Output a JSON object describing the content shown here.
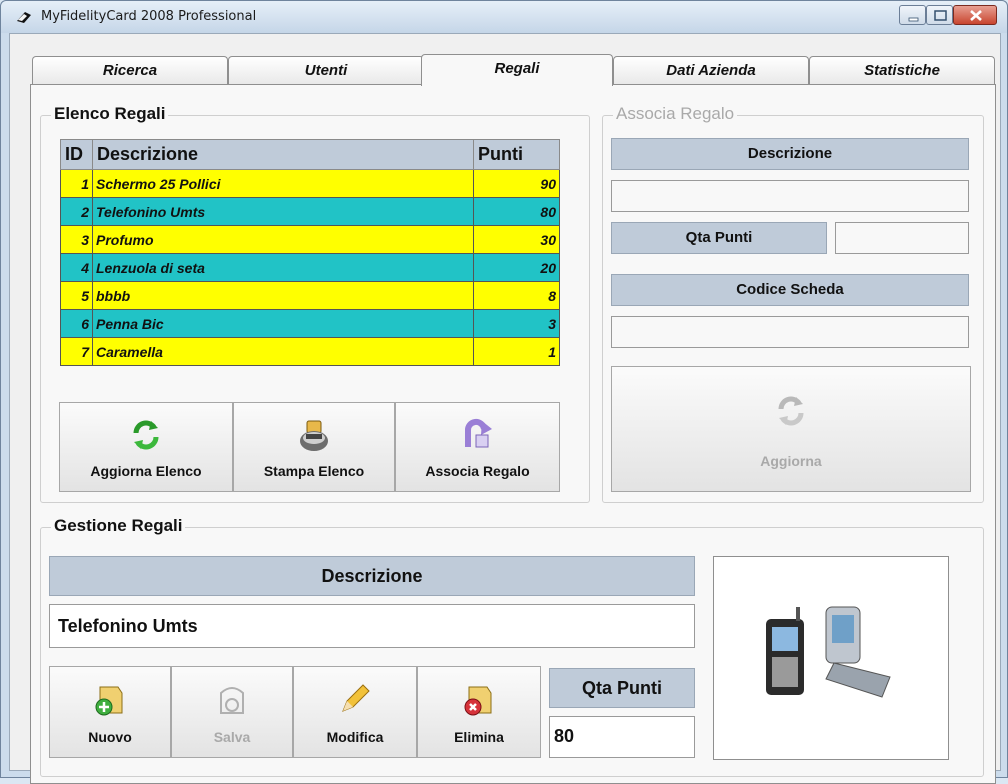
{
  "window": {
    "title": "MyFidelityCard 2008 Professional"
  },
  "tabs": [
    {
      "label": "Ricerca"
    },
    {
      "label": "Utenti"
    },
    {
      "label": "Regali"
    },
    {
      "label": "Dati Azienda"
    },
    {
      "label": "Statistiche"
    }
  ],
  "active_tab": "Regali",
  "elenco": {
    "title": "Elenco Regali",
    "columns": {
      "id": "ID",
      "desc": "Descrizione",
      "points": "Punti"
    },
    "rows": [
      {
        "id": "1",
        "desc": "Schermo 25 Pollici",
        "points": "90"
      },
      {
        "id": "2",
        "desc": "Telefonino Umts",
        "points": "80"
      },
      {
        "id": "3",
        "desc": "Profumo",
        "points": "30"
      },
      {
        "id": "4",
        "desc": "Lenzuola di seta",
        "points": "20"
      },
      {
        "id": "5",
        "desc": "bbbb",
        "points": "8"
      },
      {
        "id": "6",
        "desc": "Penna Bic",
        "points": "3"
      },
      {
        "id": "7",
        "desc": "Caramella",
        "points": "1"
      }
    ],
    "buttons": {
      "aggiorna": "Aggiorna Elenco",
      "stampa": "Stampa Elenco",
      "associa": "Associa Regalo"
    }
  },
  "associa": {
    "title": "Associa Regalo",
    "descrizione_label": "Descrizione",
    "descrizione_value": "",
    "qta_label": "Qta Punti",
    "qta_value": "",
    "codice_label": "Codice Scheda",
    "codice_value": "",
    "aggiorna_label": "Aggiorna"
  },
  "gestione": {
    "title": "Gestione Regali",
    "descrizione_label": "Descrizione",
    "descrizione_value": "Telefonino Umts",
    "qta_label": "Qta Punti",
    "qta_value": "80",
    "buttons": {
      "nuovo": "Nuovo",
      "salva": "Salva",
      "modifica": "Modifica",
      "elimina": "Elimina"
    }
  },
  "colors": {
    "row_yellow": "#ffff00",
    "row_teal": "#21c3c6",
    "header_bg": "#bfcbd9"
  },
  "icons": [
    "app-icon",
    "minimize-icon",
    "maximize-icon",
    "close-icon",
    "refresh-icon",
    "printer-icon",
    "gift-arrow-icon",
    "add-document-icon",
    "save-icon",
    "pencil-icon",
    "delete-document-icon"
  ]
}
